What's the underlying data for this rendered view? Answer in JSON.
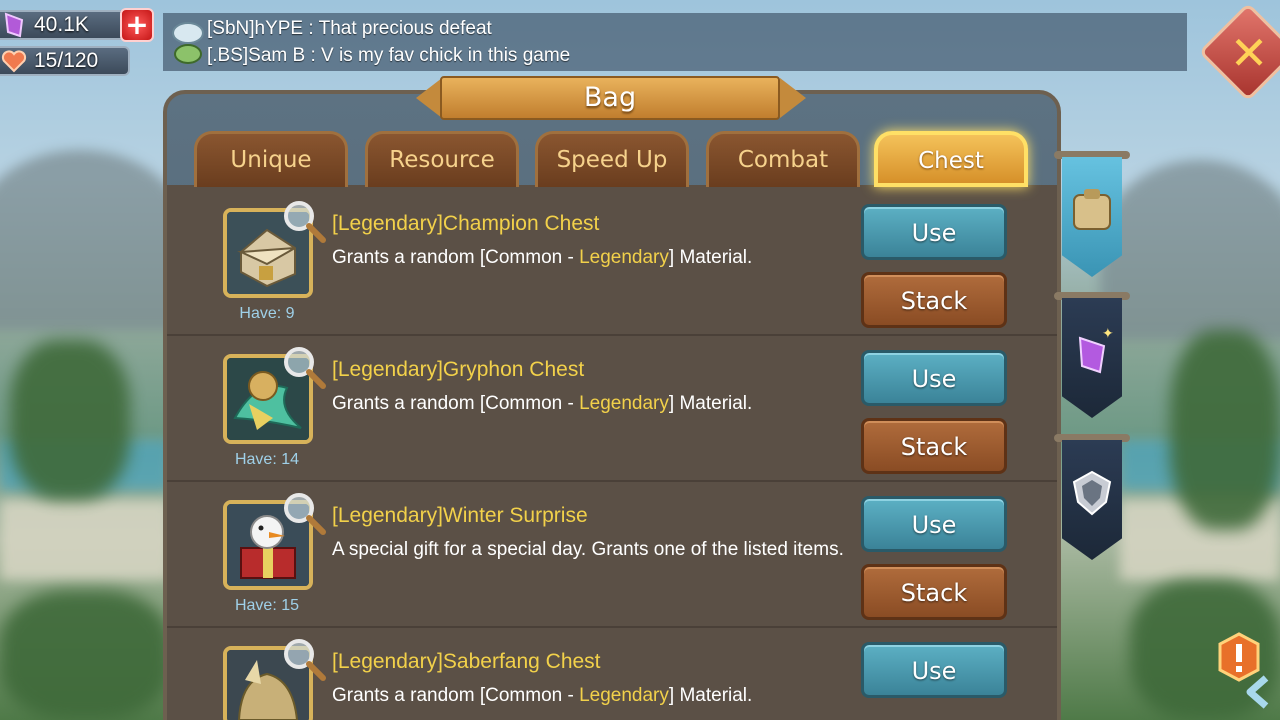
{
  "resources": {
    "gems": "40.1K",
    "stamina": "15/120"
  },
  "chat": {
    "line1": "[SbN]hYPE : That precious defeat",
    "line2": "[.BS]Sam B : V is my fav chick in this game"
  },
  "panel": {
    "title": "Bag"
  },
  "tabs": [
    {
      "label": "Unique",
      "active": false
    },
    {
      "label": "Resource",
      "active": false
    },
    {
      "label": "Speed Up",
      "active": false
    },
    {
      "label": "Combat",
      "active": false
    },
    {
      "label": "Chest",
      "active": true
    }
  ],
  "items": [
    {
      "name": "[Legendary]Champion Chest",
      "desc_pre": "Grants a random [Common - ",
      "desc_hl": "Legendary",
      "desc_post": "] Material.",
      "have": "Have: 9",
      "use_label": "Use",
      "stack_label": "Stack",
      "icon": "champion-chest-icon"
    },
    {
      "name": "[Legendary]Gryphon Chest",
      "desc_pre": "Grants a random [Common - ",
      "desc_hl": "Legendary",
      "desc_post": "] Material.",
      "have": "Have: 14",
      "use_label": "Use",
      "stack_label": "Stack",
      "icon": "gryphon-chest-icon"
    },
    {
      "name": "[Legendary]Winter Surprise",
      "desc_pre": "A special gift for a special day. Grants one of the listed items.",
      "desc_hl": "",
      "desc_post": "",
      "have": "Have: 15",
      "use_label": "Use",
      "stack_label": "Stack",
      "icon": "winter-surprise-icon"
    },
    {
      "name": "[Legendary]Saberfang Chest",
      "desc_pre": "Grants a random [Common - ",
      "desc_hl": "Legendary",
      "desc_post": "] Material.",
      "have": "",
      "use_label": "Use",
      "stack_label": "",
      "icon": "saberfang-chest-icon"
    }
  ],
  "side_tabs": [
    "bag-items-icon",
    "gem-icon",
    "shield-icon"
  ],
  "colors": {
    "accent_gold": "#f2d14a",
    "use_button": "#4a9db2",
    "stack_button": "#9c5c30",
    "panel_bg": "#5b5046"
  }
}
